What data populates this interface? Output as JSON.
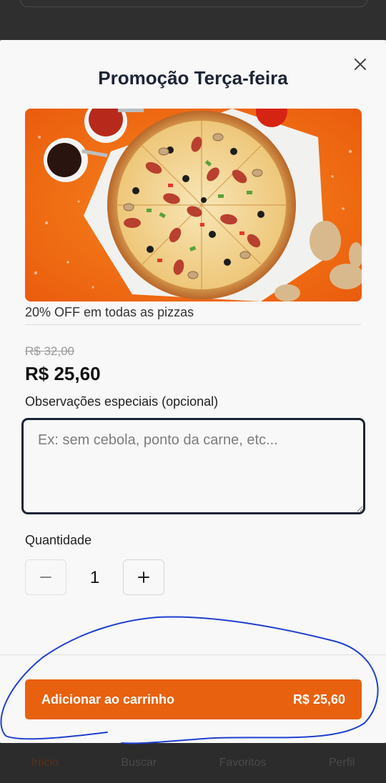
{
  "modal": {
    "title": "Promoção Terça-feira",
    "promo_description": "20% OFF em todas as pizzas",
    "old_price": "R$ 32,00",
    "new_price": "R$ 25,60",
    "notes": {
      "label": "Observações especiais (opcional)",
      "placeholder": "Ex: sem cebola, ponto da carne, etc...",
      "value": ""
    },
    "quantity": {
      "label": "Quantidade",
      "value": "1"
    },
    "add_to_cart": {
      "label": "Adicionar ao carrinho",
      "price": "R$ 25,60"
    }
  },
  "bottom_nav": {
    "items": [
      {
        "label": "Início",
        "active": true
      },
      {
        "label": "Buscar",
        "active": false
      },
      {
        "label": "Favoritos",
        "active": false
      },
      {
        "label": "Perfil",
        "active": false
      }
    ]
  },
  "colors": {
    "accent": "#e8610f",
    "title": "#1c2434",
    "annotation_stroke": "#1f3fcf"
  },
  "icons": {
    "close": "close-icon",
    "minus": "minus-icon",
    "plus": "plus-icon"
  }
}
